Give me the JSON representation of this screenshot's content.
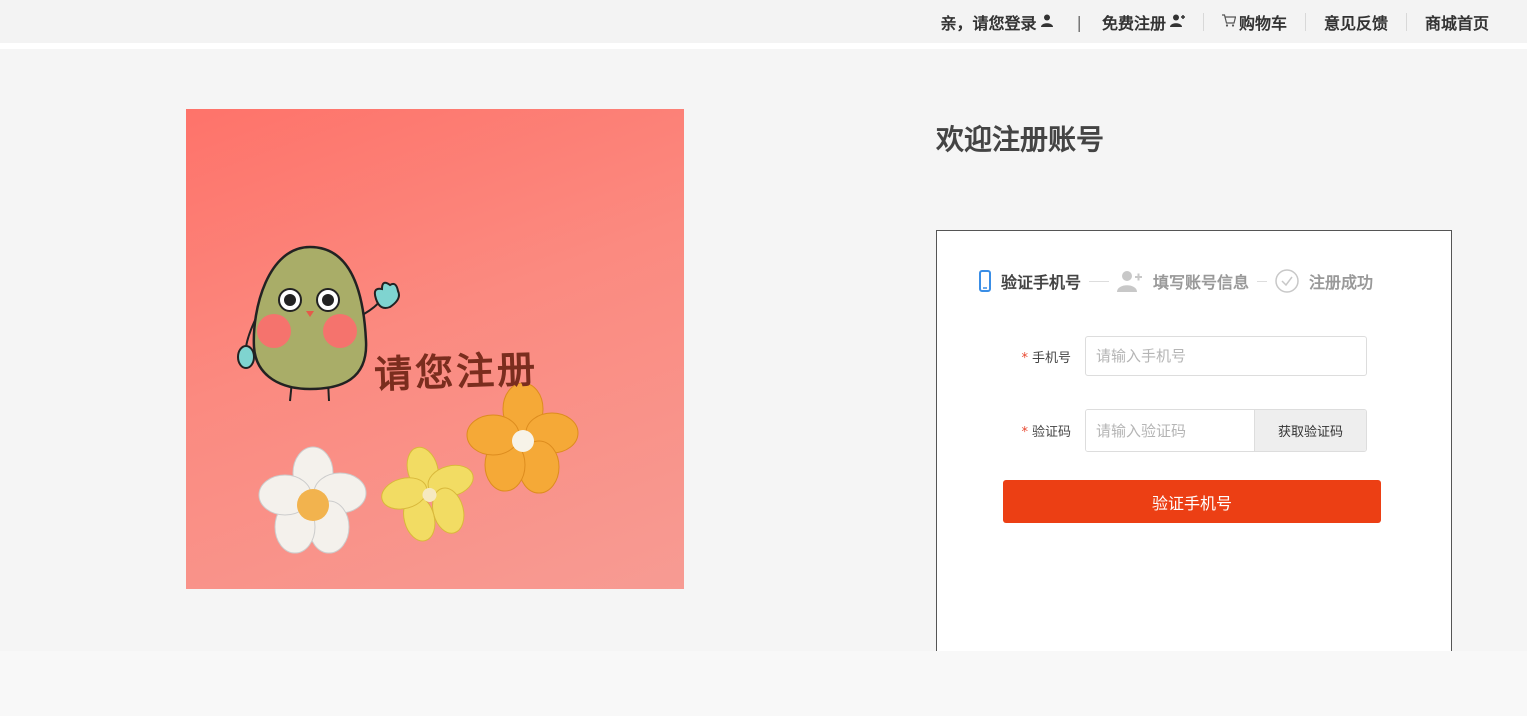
{
  "topbar": {
    "login": "亲，请您登录",
    "pipe": "|",
    "register": "免费注册",
    "cart": "购物车",
    "feedback": "意见反馈",
    "home": "商城首页"
  },
  "banner": {
    "text": "请您注册"
  },
  "welcome_title": "欢迎注册账号",
  "steps": [
    {
      "label": "验证手机号",
      "state": "active",
      "icon": "mobile-phone-icon"
    },
    {
      "label": "填写账号信息",
      "state": "inactive",
      "icon": "user-add-icon"
    },
    {
      "label": "注册成功",
      "state": "inactive",
      "icon": "check-circle-icon"
    }
  ],
  "form": {
    "phone_label": "手机号",
    "phone_placeholder": "请输入手机号",
    "code_label": "验证码",
    "code_placeholder": "请输入验证码",
    "get_code_button": "获取验证码",
    "required_mark": "*",
    "submit_button": "验证手机号"
  },
  "colors": {
    "accent": "#ec3f14",
    "active_step_icon": "#3a8ee6",
    "banner_start": "#fe736a",
    "banner_end": "#f79b93"
  }
}
